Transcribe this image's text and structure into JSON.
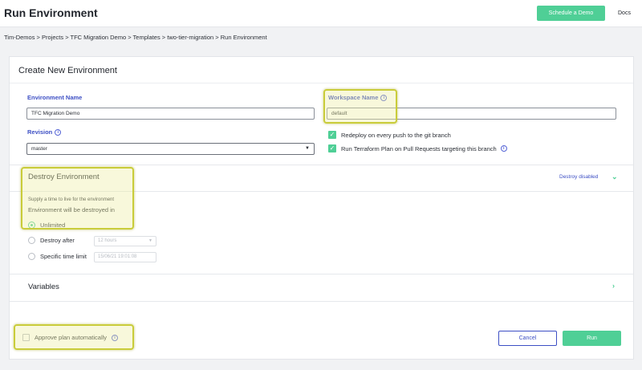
{
  "header": {
    "title": "Run Environment",
    "schedule_demo_label": "Schedule a Demo",
    "docs_label": "Docs"
  },
  "breadcrumb": "Tim-Demos > Projects > TFC Migration Demo > Templates > two-tier-migration > Run Environment",
  "form": {
    "title": "Create New Environment",
    "environment_name": {
      "label": "Environment Name",
      "value": "TFC Migration Demo"
    },
    "workspace_name": {
      "label": "Workspace Name",
      "value": "default"
    },
    "revision": {
      "label": "Revision",
      "value": "master"
    },
    "checkboxes": [
      {
        "label": "Redeploy on every push to the git branch",
        "checked": true
      },
      {
        "label": "Run Terraform Plan on Pull Requests targeting this branch",
        "checked": true
      }
    ],
    "info_glyph": "i"
  },
  "destroy": {
    "title": "Destroy Environment",
    "status": "Destroy disabled",
    "hint": "Supply a time to live for the environment",
    "subtitle": "Environment will be destroyed in",
    "options": [
      {
        "label": "Unlimited",
        "selected": true
      },
      {
        "label": "Destroy after",
        "field": "12 hours"
      },
      {
        "label": "Specific time limit",
        "field": "15/06/21 19:01:08"
      }
    ]
  },
  "variables": {
    "title": "Variables"
  },
  "footer": {
    "approve_label": "Approve plan automatically",
    "cancel_label": "Cancel",
    "run_label": "Run"
  },
  "colors": {
    "accent_green": "#4fcf96",
    "link_blue": "#3d4fc4",
    "highlight_border": "#c9cc3a"
  }
}
